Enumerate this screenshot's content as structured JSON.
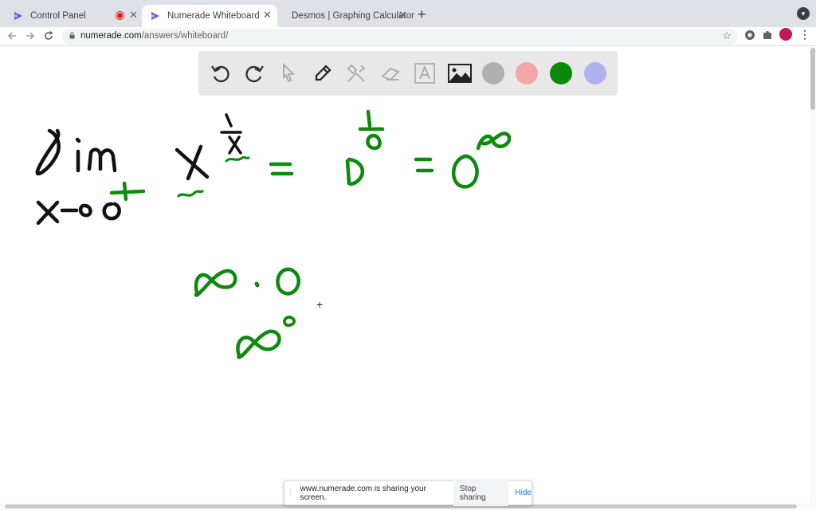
{
  "tabs": [
    {
      "title": "Control Panel",
      "recording": true
    },
    {
      "title": "Numerade Whiteboard",
      "active": true
    },
    {
      "title": "Desmos | Graphing Calculator"
    }
  ],
  "address": {
    "domain": "numerade.com",
    "path": "/answers/whiteboard/"
  },
  "icons": {
    "tabs": [
      "numerade-icon",
      "numerade-icon",
      "desmos-icon"
    ],
    "navigation": [
      "back-arrow-icon",
      "forward-arrow-icon",
      "reload-icon",
      "lock-icon",
      "bookmark-star-icon",
      "extension-icon",
      "puzzle-icon",
      "profile-icon",
      "menu-icon"
    ],
    "whiteboard_tools": [
      "undo-icon",
      "redo-icon",
      "pointer-icon",
      "pen-icon",
      "tools-icon",
      "eraser-icon",
      "text-icon",
      "image-icon"
    ]
  },
  "palette": [
    "#b0b0b0",
    "#f2a7a7",
    "#0a8a0a",
    "#b3b0ee"
  ],
  "ink_colors": {
    "black": "#111111",
    "green": "#0c8a0c"
  },
  "sharing_banner": {
    "message": "www.numerade.com is sharing your screen.",
    "stop_label": "Stop sharing",
    "hide_label": "Hide"
  }
}
